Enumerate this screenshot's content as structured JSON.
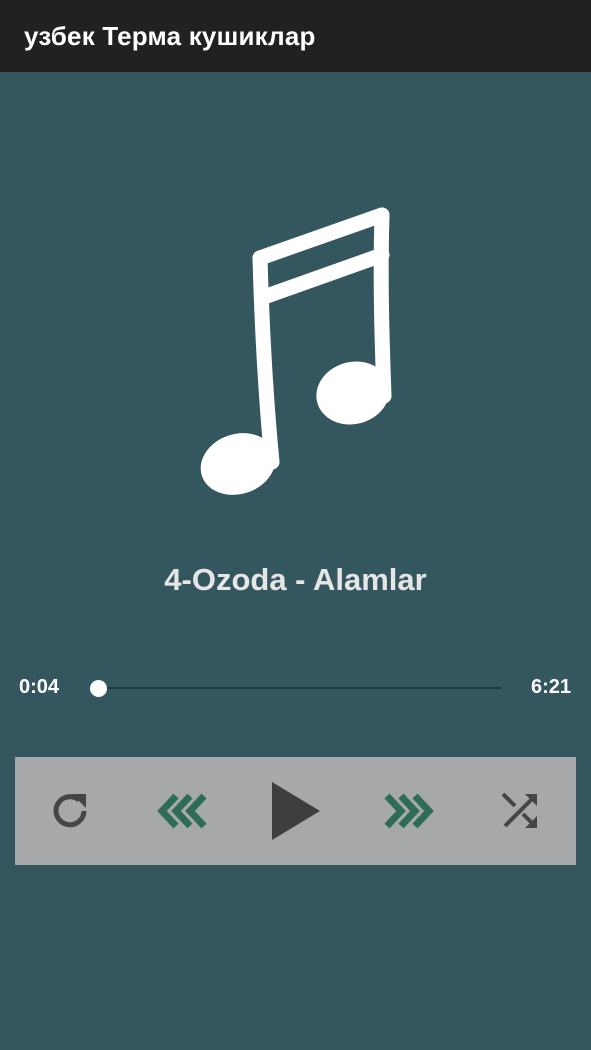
{
  "app_bar": {
    "title": "узбек Терма кушиклар"
  },
  "player": {
    "artwork_icon": "music-note-icon",
    "track_title": "4-Ozoda - Alamlar",
    "elapsed": "0:04",
    "total": "6:21",
    "progress_fraction": 0.0105,
    "controls": [
      {
        "name": "repeat-button",
        "icon": "repeat-icon"
      },
      {
        "name": "previous-button",
        "icon": "rewind-icon"
      },
      {
        "name": "play-button",
        "icon": "play-icon"
      },
      {
        "name": "next-button",
        "icon": "fast-forward-icon"
      },
      {
        "name": "shuffle-button",
        "icon": "shuffle-icon"
      }
    ]
  },
  "colors": {
    "background": "#34575f",
    "app_bar": "#212121",
    "controls_panel": "#a6a8aa",
    "skip_icons": "#2e6b58",
    "dark_icons": "#444444"
  }
}
